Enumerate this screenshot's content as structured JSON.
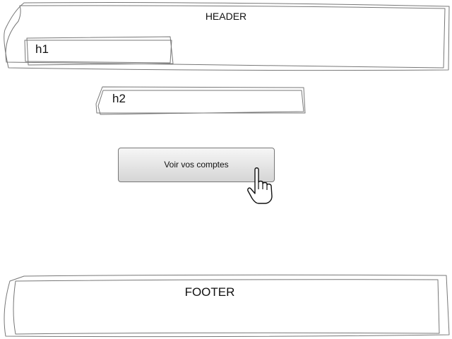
{
  "header": {
    "title": "HEADER"
  },
  "main": {
    "h1": "h1",
    "h2": "h2",
    "button_label": "Voir vos comptes"
  },
  "footer": {
    "title": "FOOTER"
  },
  "icons": {
    "cursor": "hand-pointer-icon"
  }
}
